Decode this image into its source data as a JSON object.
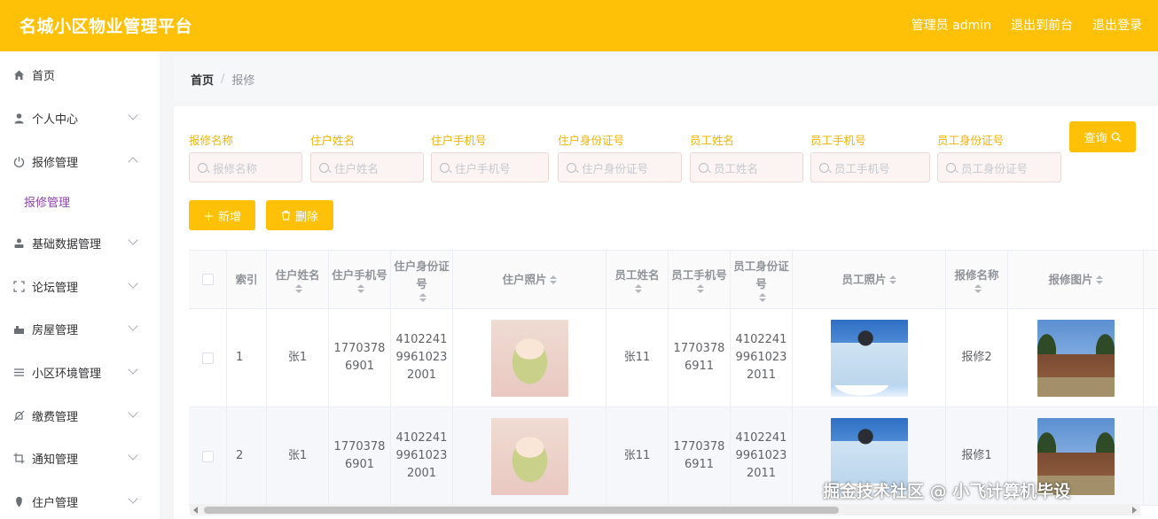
{
  "header": {
    "title": "名城小区物业管理平台",
    "admin_label": "管理员 admin",
    "to_front_label": "退出到前台",
    "logout_label": "退出登录",
    "bg_color": "#ffc107"
  },
  "sidebar": {
    "items": [
      {
        "label": "首页",
        "icon": "home-icon"
      },
      {
        "label": "个人中心",
        "icon": "user-icon"
      },
      {
        "label": "报修管理",
        "icon": "power-icon"
      },
      {
        "label": "基础数据管理",
        "icon": "user-solid-icon"
      },
      {
        "label": "论坛管理",
        "icon": "scan-icon"
      },
      {
        "label": "房屋管理",
        "icon": "house-icon"
      },
      {
        "label": "小区环境管理",
        "icon": "list-icon"
      },
      {
        "label": "缴费管理",
        "icon": "bell-off-icon"
      },
      {
        "label": "通知管理",
        "icon": "crop-icon"
      },
      {
        "label": "住户管理",
        "icon": "location-icon"
      }
    ],
    "sub_item": "报修管理"
  },
  "breadcrumb": {
    "home": "首页",
    "separator": "/",
    "current": "报修"
  },
  "filters": [
    {
      "label": "报修名称",
      "placeholder": "报修名称"
    },
    {
      "label": "住户姓名",
      "placeholder": "住户姓名"
    },
    {
      "label": "住户手机号",
      "placeholder": "住户手机号"
    },
    {
      "label": "住户身份证号",
      "placeholder": "住户身份证号"
    },
    {
      "label": "员工姓名",
      "placeholder": "员工姓名"
    },
    {
      "label": "员工手机号",
      "placeholder": "员工手机号"
    },
    {
      "label": "员工身份证号",
      "placeholder": "员工身份证号"
    }
  ],
  "buttons": {
    "search": "查询",
    "add": "＋ 新增",
    "delete": "删除"
  },
  "table": {
    "headers": [
      "索引",
      "住户姓名",
      "住户手机号",
      "住户身份证号",
      "住户照片",
      "员工姓名",
      "员工手机号",
      "员工身份证号",
      "员工照片",
      "报修名称",
      "报修图片"
    ],
    "rows": [
      {
        "index": "1",
        "resident_name": "张1",
        "resident_phone": "17703786901",
        "resident_id": "410224199610232001",
        "staff_name": "张11",
        "staff_phone": "17703786911",
        "staff_id": "410224199610232011",
        "repair_name": "报修2"
      },
      {
        "index": "2",
        "resident_name": "张1",
        "resident_phone": "17703786901",
        "resident_id": "410224199610232001",
        "staff_name": "张11",
        "staff_phone": "17703786911",
        "staff_id": "410224199610232011",
        "repair_name": "报修1"
      }
    ]
  },
  "watermark": "掘金技术社区 @ 小飞计算机毕设"
}
